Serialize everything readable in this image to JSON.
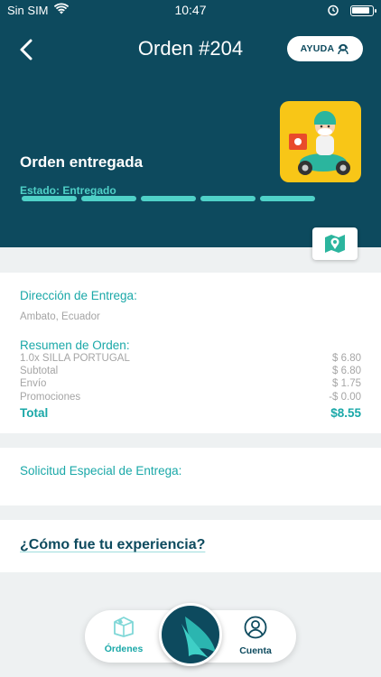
{
  "status_bar": {
    "carrier": "Sin SIM",
    "time": "10:47"
  },
  "header": {
    "title": "Orden #204",
    "help_label": "AYUDA",
    "order_state": "Orden entregada",
    "status_label": "Estado: Entregado",
    "progress_fraction": 1.0
  },
  "delivery": {
    "address_title": "Dirección de Entrega:",
    "address": "Ambato, Ecuador"
  },
  "summary": {
    "title": "Resumen de Orden:",
    "rows": [
      {
        "label": "1.0x SILLA PORTUGAL",
        "value": "$ 6.80"
      },
      {
        "label": "Subtotal",
        "value": "$ 6.80"
      },
      {
        "label": "Envío",
        "value": "$ 1.75"
      },
      {
        "label": "Promociones",
        "value": "-$ 0.00"
      }
    ],
    "total_label": "Total",
    "total_value": "$8.55"
  },
  "special_request": {
    "title": "Solicitud Especial de Entrega:"
  },
  "experience": {
    "link": "¿Cómo fue tu experiencia?"
  },
  "tabbar": {
    "orders_label": "Órdenes",
    "account_label": "Cuenta"
  },
  "colors": {
    "primary": "#0d4a5e",
    "accent": "#1aa8a8",
    "progress": "#4fd1c8",
    "highlight": "#f8c617"
  },
  "icons": [
    "back-arrow-icon",
    "headset-icon",
    "map-icon",
    "box-icon",
    "user-icon",
    "wings-logo-icon",
    "wifi-icon",
    "alarm-icon",
    "battery-icon"
  ]
}
